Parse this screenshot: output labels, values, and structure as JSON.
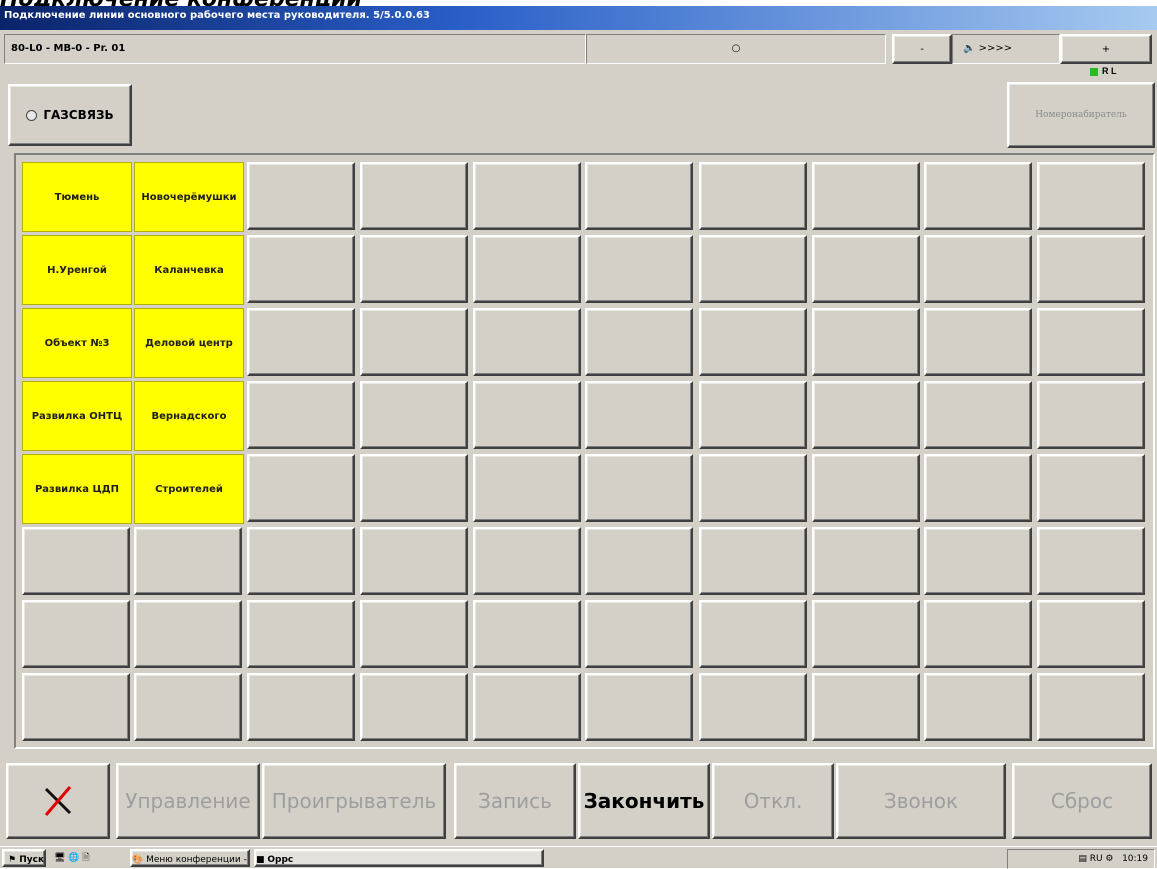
{
  "page_heading": "Подключение конференции",
  "window": {
    "title": "Подключение линии основного рабочего места руководителя. 5/5.0.0.63"
  },
  "status": {
    "left": "80-L0 - MB-0 - Pr. 01",
    "middle": "○",
    "minus": "-",
    "volume": ">>>>",
    "plus": "+",
    "rl": "R  L"
  },
  "gas_button": "ГАЗСВЯЗЬ",
  "redial_button": "Номеронабиратель",
  "grid": {
    "rows": [
      [
        "Тюмень",
        "Новочерёмушки",
        "",
        "",
        "",
        "",
        "",
        "",
        "",
        ""
      ],
      [
        "Н.Уренгой",
        "Каланчевка",
        "",
        "",
        "",
        "",
        "",
        "",
        "",
        ""
      ],
      [
        "Объект №3",
        "Деловой центр",
        "",
        "",
        "",
        "",
        "",
        "",
        "",
        ""
      ],
      [
        "Развилка ОНТЦ",
        "Вернадского",
        "",
        "",
        "",
        "",
        "",
        "",
        "",
        ""
      ],
      [
        "Развилка ЦДП",
        "Строителей",
        "",
        "",
        "",
        "",
        "",
        "",
        "",
        ""
      ],
      [
        "",
        "",
        "",
        "",
        "",
        "",
        "",
        "",
        "",
        ""
      ],
      [
        "",
        "",
        "",
        "",
        "",
        "",
        "",
        "",
        "",
        ""
      ],
      [
        "",
        "",
        "",
        "",
        "",
        "",
        "",
        "",
        "",
        ""
      ]
    ]
  },
  "bottom_buttons": [
    {
      "label": "",
      "icon": "tools-icon",
      "active": true
    },
    {
      "label": "Управление",
      "active": false
    },
    {
      "label": "Проигрыватель",
      "active": false
    },
    {
      "label": "Запись",
      "active": false
    },
    {
      "label": "Закончить",
      "active": true
    },
    {
      "label": "Откл.",
      "active": false
    },
    {
      "label": "Звонок",
      "active": false
    },
    {
      "label": "Сброс",
      "active": false
    }
  ],
  "taskbar": {
    "start": "Пуск",
    "tasks": [
      "Меню конференции - Paint",
      "Oppc"
    ],
    "clock": "10:19"
  }
}
